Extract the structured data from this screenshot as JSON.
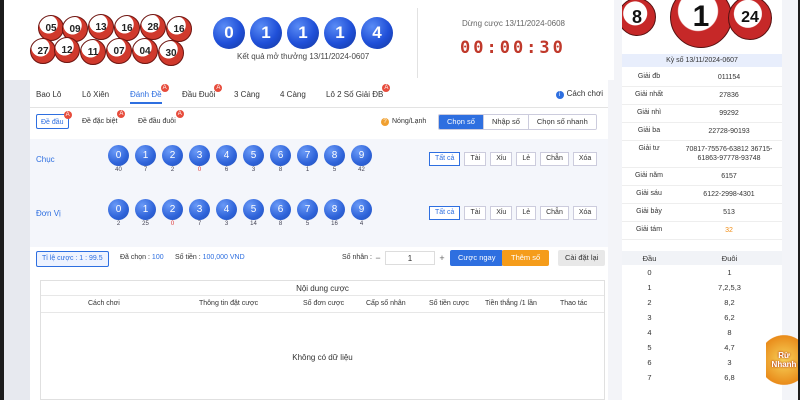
{
  "header": {
    "left_balls": [
      "05",
      "09",
      "13",
      "16",
      "28",
      "16",
      "27",
      "12",
      "11",
      "07",
      "04",
      "30"
    ],
    "result_digits": [
      "0",
      "1",
      "1",
      "1",
      "4"
    ],
    "result_title": "Kết quả mở thưởng 13/11/2024-0607",
    "countdown_title": "Dừng cược 13/11/2024-0608",
    "timer": "00:00:30"
  },
  "tabs": [
    {
      "label": "Bao Lô",
      "badge": ""
    },
    {
      "label": "Lô Xiên",
      "badge": ""
    },
    {
      "label": "Đánh Đề",
      "badge": "A"
    },
    {
      "label": "Đầu Đuôi",
      "badge": "A"
    },
    {
      "label": "3 Càng",
      "badge": ""
    },
    {
      "label": "4 Càng",
      "badge": ""
    },
    {
      "label": "Lô 2 Số Giải ĐB",
      "badge": "A"
    }
  ],
  "howto": "Cách chơi",
  "subtabs": [
    {
      "label": "Đề đầu",
      "badge": "A"
    },
    {
      "label": "Đề đặc biệt",
      "badge": "A"
    },
    {
      "label": "Đề đầu đuôi",
      "badge": "A"
    }
  ],
  "hotcold": "Nóng/Lạnh",
  "modes": [
    "Chọn số",
    "Nhập số",
    "Chọn số nhanh"
  ],
  "rows": [
    {
      "label": "Chục",
      "numbers": [
        "0",
        "1",
        "2",
        "3",
        "4",
        "5",
        "6",
        "7",
        "8",
        "9"
      ],
      "counts": [
        "40",
        "7",
        "2",
        "0",
        "6",
        "3",
        "8",
        "1",
        "5",
        "42"
      ]
    },
    {
      "label": "Đơn Vị",
      "numbers": [
        "0",
        "1",
        "2",
        "3",
        "4",
        "5",
        "6",
        "7",
        "8",
        "9"
      ],
      "counts": [
        "2",
        "25",
        "0",
        "7",
        "3",
        "14",
        "8",
        "5",
        "16",
        "4"
      ]
    }
  ],
  "quick_buttons": [
    "Tất cả",
    "Tài",
    "Xỉu",
    "Lẻ",
    "Chẵn",
    "Xóa"
  ],
  "bet": {
    "odds": "Tỉ lệ cược : 1 : 99.5",
    "selected_label": "Đã chọn : ",
    "selected_value": "100",
    "amount_label": "Số tiền : ",
    "amount_value": "100,000 VND",
    "multiplier_label": "Số nhân :",
    "minus": "−",
    "qty": "1",
    "plus": "+",
    "confirm": "Cược ngay",
    "add": "Thêm số",
    "reset": "Cài đặt lại"
  },
  "table": {
    "title": "Nội dung cược",
    "columns": [
      "Cách chơi",
      "Thông tin đặt cược",
      "Số đơn cược",
      "Cấp số nhân",
      "Số tiền cược",
      "Tiền thắng /1 lần",
      "Thao tác"
    ],
    "empty": "Không có dữ liệu"
  },
  "side": {
    "balls": [
      "8",
      "1",
      "24"
    ],
    "period": "Kỳ số 13/11/2024-0607",
    "prizes": [
      {
        "k": "Giải đb",
        "v": "011154"
      },
      {
        "k": "Giải nhất",
        "v": "27836"
      },
      {
        "k": "Giải nhì",
        "v": "99292"
      },
      {
        "k": "Giải ba",
        "v": "22728-90193"
      },
      {
        "k": "Giải tư",
        "v": "70817-75576-63812 36715-61863-97778-93748"
      },
      {
        "k": "Giải năm",
        "v": "6157"
      },
      {
        "k": "Giải sáu",
        "v": "6122-2998-4301"
      },
      {
        "k": "Giải bảy",
        "v": "513"
      },
      {
        "k": "Giải tám",
        "v": "32"
      }
    ],
    "tail_head": [
      "Đầu",
      "Đuôi"
    ],
    "tails": [
      [
        "0",
        "1"
      ],
      [
        "1",
        "7,2,5,3"
      ],
      [
        "2",
        "8,2"
      ],
      [
        "3",
        "6,2"
      ],
      [
        "4",
        "8"
      ],
      [
        "5",
        "4,7"
      ],
      [
        "6",
        "3"
      ],
      [
        "7",
        "6,8"
      ]
    ],
    "logo": [
      "Rừ",
      "Nhanh"
    ],
    "accent": "#2e6fe0",
    "highlight": "#f08c14"
  }
}
